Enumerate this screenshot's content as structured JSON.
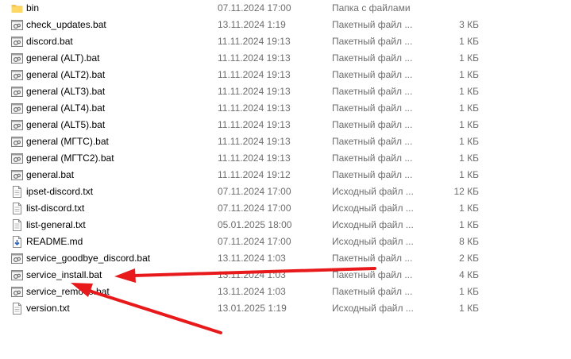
{
  "files": [
    {
      "name": "bin",
      "date": "07.11.2024 17:00",
      "type": "Папка с файлами",
      "size": "",
      "icon": "folder-icon"
    },
    {
      "name": "check_updates.bat",
      "date": "13.11.2024 1:19",
      "type": "Пакетный файл ...",
      "size": "3 КБ",
      "icon": "batch-file-icon"
    },
    {
      "name": "discord.bat",
      "date": "11.11.2024 19:13",
      "type": "Пакетный файл ...",
      "size": "1 КБ",
      "icon": "batch-file-icon"
    },
    {
      "name": "general (ALT).bat",
      "date": "11.11.2024 19:13",
      "type": "Пакетный файл ...",
      "size": "1 КБ",
      "icon": "batch-file-icon"
    },
    {
      "name": "general (ALT2).bat",
      "date": "11.11.2024 19:13",
      "type": "Пакетный файл ...",
      "size": "1 КБ",
      "icon": "batch-file-icon"
    },
    {
      "name": "general (ALT3).bat",
      "date": "11.11.2024 19:13",
      "type": "Пакетный файл ...",
      "size": "1 КБ",
      "icon": "batch-file-icon"
    },
    {
      "name": "general (ALT4).bat",
      "date": "11.11.2024 19:13",
      "type": "Пакетный файл ...",
      "size": "1 КБ",
      "icon": "batch-file-icon"
    },
    {
      "name": "general (ALT5).bat",
      "date": "11.11.2024 19:13",
      "type": "Пакетный файл ...",
      "size": "1 КБ",
      "icon": "batch-file-icon"
    },
    {
      "name": "general (МГТС).bat",
      "date": "11.11.2024 19:13",
      "type": "Пакетный файл ...",
      "size": "1 КБ",
      "icon": "batch-file-icon"
    },
    {
      "name": "general (МГТС2).bat",
      "date": "11.11.2024 19:13",
      "type": "Пакетный файл ...",
      "size": "1 КБ",
      "icon": "batch-file-icon"
    },
    {
      "name": "general.bat",
      "date": "11.11.2024 19:12",
      "type": "Пакетный файл ...",
      "size": "1 КБ",
      "icon": "batch-file-icon"
    },
    {
      "name": "ipset-discord.txt",
      "date": "07.11.2024 17:00",
      "type": "Исходный файл ...",
      "size": "12 КБ",
      "icon": "text-file-icon"
    },
    {
      "name": "list-discord.txt",
      "date": "07.11.2024 17:00",
      "type": "Исходный файл ...",
      "size": "1 КБ",
      "icon": "text-file-icon"
    },
    {
      "name": "list-general.txt",
      "date": "05.01.2025 18:00",
      "type": "Исходный файл ...",
      "size": "1 КБ",
      "icon": "text-file-icon"
    },
    {
      "name": "README.md",
      "date": "07.11.2024 17:00",
      "type": "Исходный файл ...",
      "size": "8 КБ",
      "icon": "markdown-file-icon"
    },
    {
      "name": "service_goodbye_discord.bat",
      "date": "13.11.2024 1:03",
      "type": "Пакетный файл ...",
      "size": "2 КБ",
      "icon": "batch-file-icon"
    },
    {
      "name": "service_install.bat",
      "date": "13.11.2024 1:03",
      "type": "Пакетный файл ...",
      "size": "4 КБ",
      "icon": "batch-file-icon"
    },
    {
      "name": "service_remove.bat",
      "date": "13.11.2024 1:03",
      "type": "Пакетный файл ...",
      "size": "1 КБ",
      "icon": "batch-file-icon"
    },
    {
      "name": "version.txt",
      "date": "13.01.2025 1:19",
      "type": "Исходный файл ...",
      "size": "1 КБ",
      "icon": "text-file-icon"
    }
  ],
  "annotation": {
    "arrow_color": "#e8191a",
    "target_file": "service_install.bat"
  }
}
